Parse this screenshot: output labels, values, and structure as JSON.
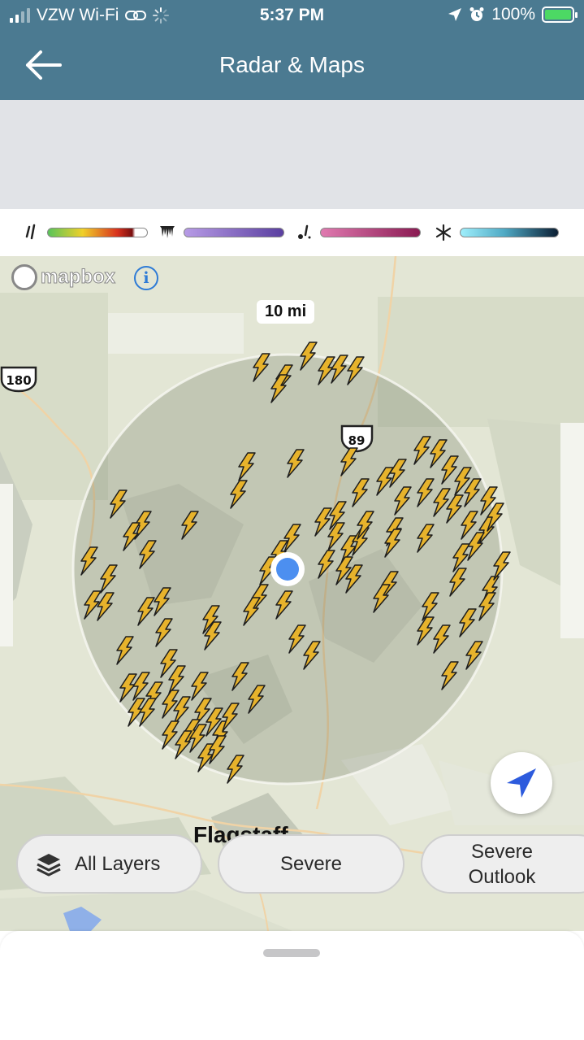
{
  "status_bar": {
    "carrier": "VZW Wi-Fi",
    "time": "5:37 PM",
    "battery": "100%",
    "icons": [
      "signal-icon",
      "link-icon",
      "activity-spinner-icon",
      "location-arrow-icon",
      "alarm-icon",
      "battery-charging-icon"
    ]
  },
  "nav": {
    "title": "Radar & Maps",
    "back_icon": "arrow-left-icon"
  },
  "legend": {
    "items": [
      {
        "type": "rain",
        "icon": "rain-drop-icon",
        "gradient": [
          "#58c45a",
          "#f0d02a",
          "#d8321e",
          "#7a0f0f",
          "#ffffff"
        ]
      },
      {
        "type": "ice",
        "icon": "icicle-icon",
        "gradient": [
          "#b79be6",
          "#5a3fa0"
        ]
      },
      {
        "type": "mix",
        "icon": "mixed-precip-icon",
        "gradient": [
          "#e07ab0",
          "#8a1a52"
        ]
      },
      {
        "type": "snow",
        "icon": "snowflake-icon",
        "gradient": [
          "#9feffc",
          "#4fa9c4",
          "#0b1e33"
        ]
      }
    ]
  },
  "map": {
    "attribution": "mapbox",
    "scale_label": "10 mi",
    "shields": [
      "180",
      "89"
    ],
    "city": "Flagstaff",
    "lightning_color": "#e7b32c",
    "location_dot_color": "#4c8ff0"
  },
  "filters": {
    "all_layers": "All Layers",
    "severe": "Severe",
    "severe_outlook": "Severe\nOutlook"
  }
}
